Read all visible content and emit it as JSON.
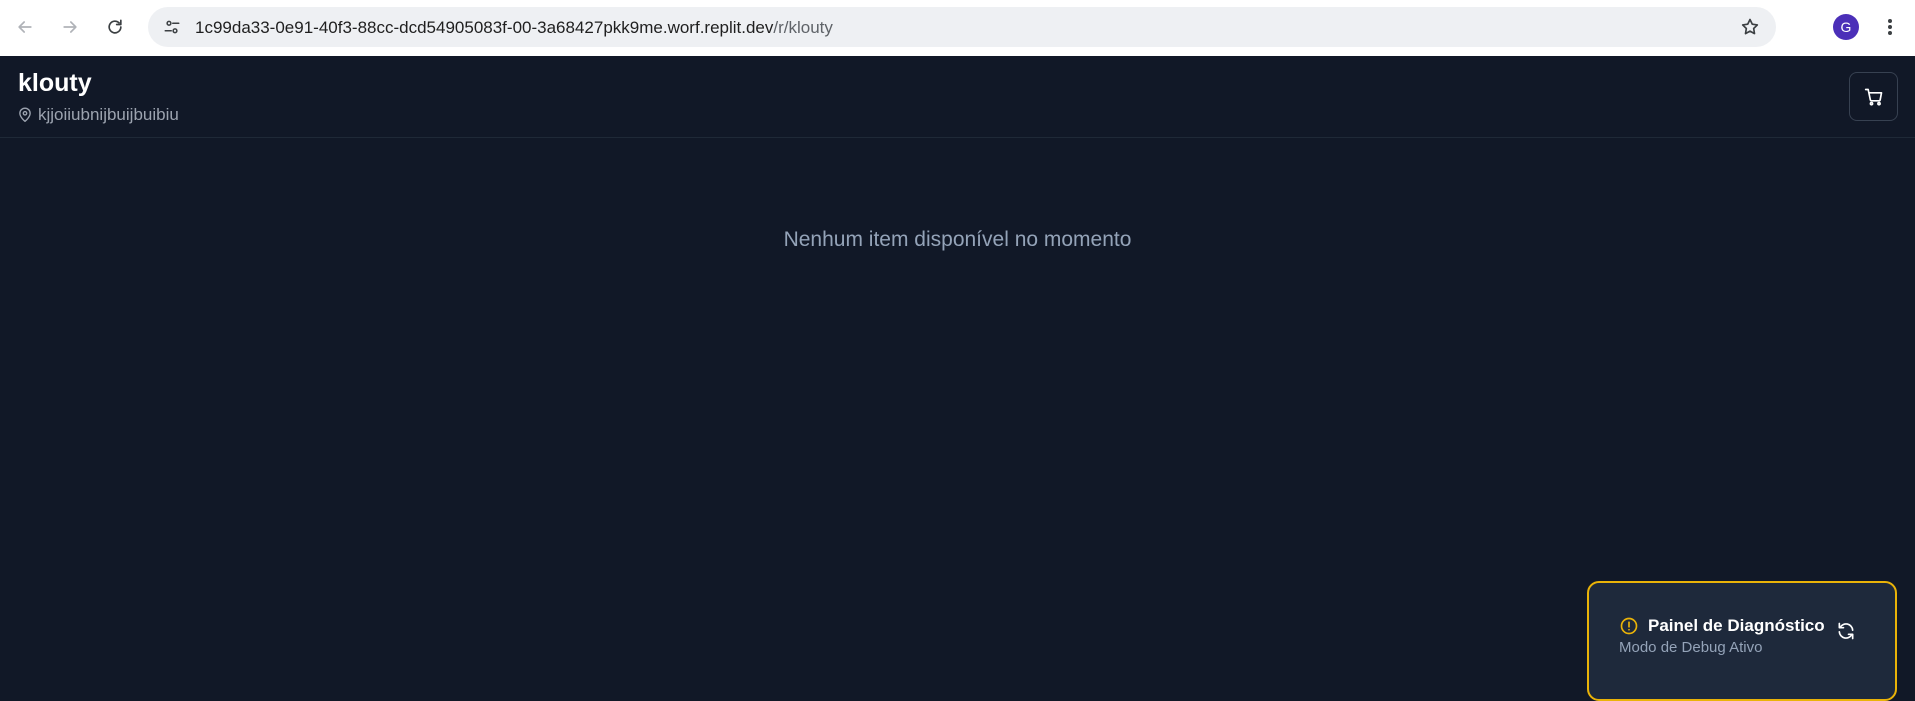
{
  "browser": {
    "url_host": "1c99da33-0e91-40f3-88cc-dcd54905083f-00-3a68427pkk9me.worf.replit.dev",
    "url_path": "/r/klouty",
    "profile_initial": "G"
  },
  "header": {
    "title": "klouty",
    "location": "kjjoiiubnijbuijbuibiu"
  },
  "main": {
    "empty_message": "Nenhum item disponível no momento"
  },
  "diagnostics": {
    "title": "Painel de Diagnóstico",
    "subtitle": "Modo de Debug Ativo"
  },
  "icons": {
    "back": "arrow-left-icon",
    "forward": "arrow-right-icon",
    "reload": "reload-icon",
    "site_info": "tune-icon",
    "bookmark": "star-icon",
    "menu": "more-vert-icon",
    "location": "map-pin-icon",
    "cart": "shopping-cart-icon",
    "warning": "alert-circle-icon",
    "refresh": "refresh-icon"
  },
  "colors": {
    "background": "#111827",
    "accent_warning": "#eab308",
    "avatar": "#4b2fb8"
  }
}
